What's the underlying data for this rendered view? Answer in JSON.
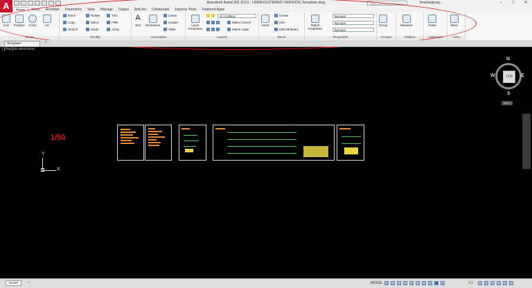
{
  "app": {
    "logo_letter": "A",
    "title": "Autodesk AutoCAD 2019 - UNREGISTERED VERSION   Template.dwg",
    "search_placeholder": "Type a keyword or phrase",
    "user": "thaidangiong..."
  },
  "ribbon_tabs": [
    {
      "label": "Home"
    },
    {
      "label": "Insert"
    },
    {
      "label": "Annotate"
    },
    {
      "label": "Parametric"
    },
    {
      "label": "View"
    },
    {
      "label": "Manage"
    },
    {
      "label": "Output"
    },
    {
      "label": "Add-ins"
    },
    {
      "label": "Collaborate"
    },
    {
      "label": "Express Tools"
    },
    {
      "label": "Featured Apps"
    }
  ],
  "draw_panel": {
    "label": "Draw",
    "tools": [
      "Line",
      "Polyline",
      "Circle",
      "Arc"
    ]
  },
  "modify_panel": {
    "label": "Modify",
    "tools": [
      "Move",
      "Rotate",
      "Trim",
      "Copy",
      "Mirror",
      "Fillet",
      "Stretch",
      "Scale",
      "Array"
    ]
  },
  "annotation_panel": {
    "label": "Annotation",
    "text": "Text",
    "dimension": "Dimension",
    "linear": "Linear",
    "leader": "Leader",
    "table": "Table"
  },
  "layers_panel": {
    "label": "Layers",
    "layer_properties": "Layer Properties",
    "layer_combo": "1C-CotBep",
    "make_current": "Make Current",
    "match_layer": "Match Layer"
  },
  "block_panel": {
    "label": "Block",
    "insert": "Insert",
    "create": "Create",
    "edit": "Edit",
    "edit_attributes": "Edit Attributes"
  },
  "properties_panel": {
    "label": "Properties",
    "match_properties": "Match Properties",
    "color": "ByLayer",
    "linetype": "ByLayer",
    "lineweight": "ByLayer"
  },
  "groups_panel": {
    "label": "Groups",
    "group": "Group"
  },
  "utilities_panel": {
    "label": "Utilities",
    "measure": "Measure"
  },
  "clipboard_panel": {
    "label": "Clipboard",
    "paste": "Paste"
  },
  "view_panel": {
    "label": "View",
    "base": "Base"
  },
  "file_tab": {
    "label": "Template*"
  },
  "viewport": {
    "label": "[-][Top][2D Wireframe]",
    "scale_text": "1/50"
  },
  "viewcube": {
    "face": "TOP",
    "north": "N",
    "south": "S",
    "east": "E",
    "west": "W",
    "wcs": "WCS"
  },
  "ucs": {
    "x": "X",
    "y": "Y"
  },
  "layout_tabs": [
    {
      "label": "Model"
    },
    {
      "label": "+"
    }
  ],
  "status": {
    "model": "MODEL",
    "annotation_scale": "1:1"
  },
  "colors": {
    "annotation_red": "#d11111",
    "cad_background": "#000000",
    "scale_text": "#e01b1b"
  }
}
